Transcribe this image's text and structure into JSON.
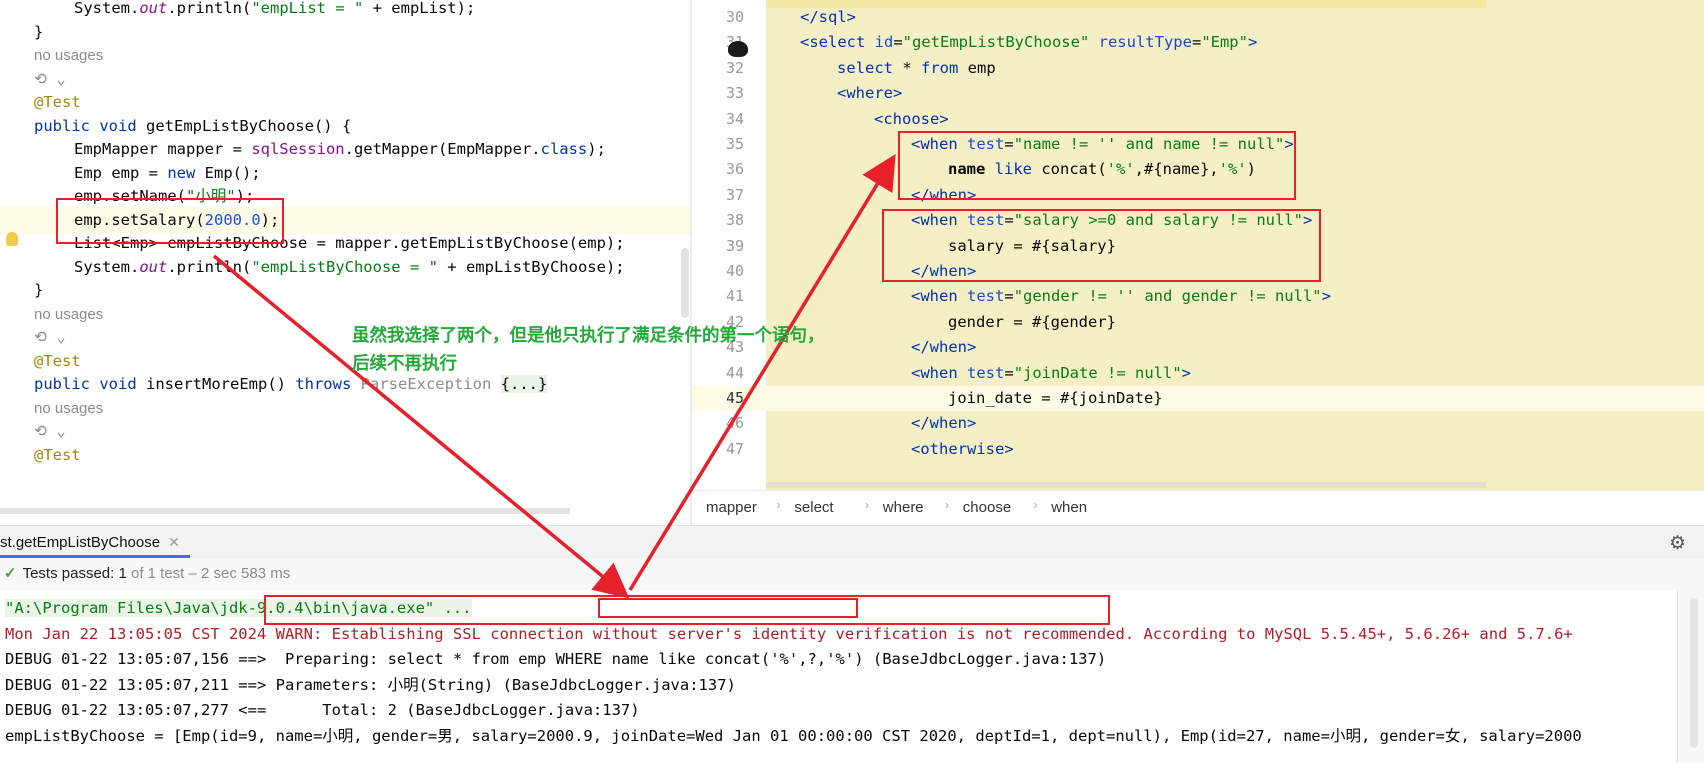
{
  "left_editor": {
    "lines": [
      {
        "kind": "code",
        "indent": true,
        "segments": [
          [
            "System.",
            ""
          ],
          [
            "out",
            "itl"
          ],
          [
            ".println(",
            ""
          ],
          [
            "\"empList = \"",
            "str"
          ],
          [
            " + empList);",
            ""
          ]
        ]
      },
      {
        "kind": "code",
        "indent": false,
        "segments": [
          [
            "}",
            ""
          ]
        ]
      },
      {
        "kind": "usage",
        "text": "no usages"
      },
      {
        "kind": "icon",
        "text": "⟲ ⌄"
      },
      {
        "kind": "code",
        "indent": false,
        "segments": [
          [
            "@Test",
            "ann"
          ]
        ]
      },
      {
        "kind": "code",
        "indent": false,
        "segments": [
          [
            "public",
            "kw"
          ],
          [
            " ",
            ""
          ],
          [
            "void",
            "kw"
          ],
          [
            " getEmpListByChoose() {",
            ""
          ]
        ]
      },
      {
        "kind": "code",
        "indent": true,
        "segments": [
          [
            "EmpMapper mapper = ",
            ""
          ],
          [
            "sqlSession",
            "fld"
          ],
          [
            ".getMapper(EmpMapper.",
            ""
          ],
          [
            "class",
            "kw"
          ],
          [
            ");",
            ""
          ]
        ]
      },
      {
        "kind": "code",
        "indent": true,
        "segments": [
          [
            "Emp emp = ",
            ""
          ],
          [
            "new",
            "kw"
          ],
          [
            " Emp();",
            ""
          ]
        ]
      },
      {
        "kind": "code",
        "indent": true,
        "segments": [
          [
            "emp.setName(",
            ""
          ],
          [
            "\"小明\"",
            "str"
          ],
          [
            ");",
            ""
          ]
        ]
      },
      {
        "kind": "code",
        "indent": true,
        "hl": true,
        "segments": [
          [
            "emp.setSalary(",
            ""
          ],
          [
            "2000.0",
            "num"
          ],
          [
            ");",
            ""
          ]
        ]
      },
      {
        "kind": "code",
        "indent": true,
        "segments": [
          [
            "List<Emp> empListByChoose = mapper.getEmpListByChoose(emp);",
            ""
          ]
        ]
      },
      {
        "kind": "code",
        "indent": true,
        "segments": [
          [
            "System.",
            ""
          ],
          [
            "out",
            "itl"
          ],
          [
            ".println(",
            ""
          ],
          [
            "\"empListByChoose = \"",
            "str"
          ],
          [
            " + empListByChoose);",
            ""
          ]
        ]
      },
      {
        "kind": "code",
        "indent": false,
        "segments": [
          [
            "}",
            ""
          ]
        ]
      },
      {
        "kind": "usage",
        "text": "no usages"
      },
      {
        "kind": "icon",
        "text": "⟲ ⌄"
      },
      {
        "kind": "code",
        "indent": false,
        "segments": [
          [
            "@Test",
            "ann"
          ]
        ]
      },
      {
        "kind": "code",
        "indent": false,
        "segments": [
          [
            "public",
            "kw"
          ],
          [
            " ",
            ""
          ],
          [
            "void",
            "kw"
          ],
          [
            " insertMoreEmp() ",
            ""
          ],
          [
            "throws",
            "kw"
          ],
          [
            " ",
            ""
          ],
          [
            "ParseException",
            "grey"
          ],
          [
            " ",
            ""
          ],
          [
            "{...}",
            "fold"
          ]
        ]
      },
      {
        "kind": "usage",
        "text": "no usages"
      },
      {
        "kind": "icon",
        "text": "⟲ ⌄"
      },
      {
        "kind": "code",
        "indent": false,
        "segments": [
          [
            "@Test",
            "ann"
          ]
        ]
      }
    ]
  },
  "right_editor": {
    "lines": [
      {
        "n": "30",
        "indent": 1,
        "segments": [
          [
            "</sql>",
            "tag"
          ]
        ]
      },
      {
        "n": "31",
        "indent": 1,
        "segments": [
          [
            "<select",
            "tag"
          ],
          [
            " id",
            "attr"
          ],
          [
            "=",
            ""
          ],
          [
            "\"getEmpListByChoose\"",
            "aval"
          ],
          [
            " resultType",
            "attr"
          ],
          [
            "=",
            ""
          ],
          [
            "\"Emp\"",
            "aval"
          ],
          [
            ">",
            "tag"
          ]
        ]
      },
      {
        "n": "32",
        "indent": 2,
        "segments": [
          [
            "select",
            "kw"
          ],
          [
            " * ",
            ""
          ],
          [
            "from",
            "kw"
          ],
          [
            " emp",
            ""
          ]
        ]
      },
      {
        "n": "33",
        "indent": 2,
        "segments": [
          [
            "<where>",
            "tag"
          ]
        ]
      },
      {
        "n": "34",
        "indent": 3,
        "segments": [
          [
            "<choose>",
            "tag"
          ]
        ]
      },
      {
        "n": "35",
        "indent": 4,
        "segments": [
          [
            "<when",
            "tag"
          ],
          [
            " test",
            "attr"
          ],
          [
            "=",
            ""
          ],
          [
            "\"name != '' and name != null\"",
            "aval"
          ],
          [
            ">",
            "tag"
          ]
        ]
      },
      {
        "n": "36",
        "indent": 5,
        "segments": [
          [
            "name",
            "bold"
          ],
          [
            " ",
            ""
          ],
          [
            "like",
            "kw"
          ],
          [
            " concat(",
            ""
          ],
          [
            "'%'",
            "aval"
          ],
          [
            ",#{name},",
            ""
          ],
          [
            "'%'",
            "aval"
          ],
          [
            ")",
            ""
          ]
        ]
      },
      {
        "n": "37",
        "indent": 4,
        "segments": [
          [
            "</when>",
            "tag"
          ]
        ]
      },
      {
        "n": "38",
        "indent": 4,
        "segments": [
          [
            "<when",
            "tag"
          ],
          [
            " test",
            "attr"
          ],
          [
            "=",
            ""
          ],
          [
            "\"salary >=0 and salary != null\"",
            "aval"
          ],
          [
            ">",
            "tag"
          ]
        ]
      },
      {
        "n": "39",
        "indent": 5,
        "segments": [
          [
            "salary = #{salary}",
            ""
          ]
        ]
      },
      {
        "n": "40",
        "indent": 4,
        "segments": [
          [
            "</when>",
            "tag"
          ]
        ]
      },
      {
        "n": "41",
        "indent": 4,
        "segments": [
          [
            "<when",
            "tag"
          ],
          [
            " test",
            "attr"
          ],
          [
            "=",
            ""
          ],
          [
            "\"gender != '' and gender != null\"",
            "aval"
          ],
          [
            ">",
            "tag"
          ]
        ]
      },
      {
        "n": "42",
        "indent": 5,
        "segments": [
          [
            "gender = #{gender}",
            ""
          ]
        ]
      },
      {
        "n": "43",
        "indent": 4,
        "segments": [
          [
            "</when>",
            "tag"
          ]
        ]
      },
      {
        "n": "44",
        "indent": 4,
        "segments": [
          [
            "<when",
            "tag"
          ],
          [
            " test",
            "attr"
          ],
          [
            "=",
            ""
          ],
          [
            "\"joinDate != null\"",
            "aval"
          ],
          [
            ">",
            "tag"
          ]
        ]
      },
      {
        "n": "45",
        "indent": 5,
        "cur": true,
        "segments": [
          [
            "join_date = #{joinDate}",
            ""
          ]
        ]
      },
      {
        "n": "46",
        "indent": 4,
        "segments": [
          [
            "</when>",
            "tag"
          ]
        ]
      },
      {
        "n": "47",
        "indent": 4,
        "segments": [
          [
            "<otherwise>",
            "tag"
          ]
        ]
      }
    ]
  },
  "breadcrumb": [
    "mapper",
    "select",
    "where",
    "choose",
    "when"
  ],
  "run_panel": {
    "tab_label": "st.getEmpListByChoose",
    "status_label": "Tests passed:",
    "status_count": "1",
    "status_detail": "of 1 test – 2 sec 583 ms"
  },
  "console": {
    "lines": [
      {
        "cls": "cmd-path",
        "text": "\"A:\\Program Files\\Java\\jdk-9.0.4\\bin\\java.exe\" ..."
      },
      {
        "cls": "warn",
        "text": "Mon Jan 22 13:05:05 CST 2024 WARN: Establishing SSL connection without server's identity verification is not recommended. According to MySQL 5.5.45+, 5.6.26+ and 5.7.6+"
      },
      {
        "cls": "",
        "text": "DEBUG 01-22 13:05:07,156 ==>  Preparing: select * from emp WHERE name like concat('%',?,'%') (BaseJdbcLogger.java:137)"
      },
      {
        "cls": "",
        "text": "DEBUG 01-22 13:05:07,211 ==> Parameters: 小明(String) (BaseJdbcLogger.java:137)"
      },
      {
        "cls": "",
        "text": "DEBUG 01-22 13:05:07,277 <==      Total: 2 (BaseJdbcLogger.java:137)"
      },
      {
        "cls": "",
        "text": "empListByChoose = [Emp(id=9, name=小明, gender=男, salary=2000.9, joinDate=Wed Jan 01 00:00:00 CST 2020, deptId=1, dept=null), Emp(id=27, name=小明, gender=女, salary=2000"
      }
    ]
  },
  "annotation": {
    "line1": "虽然我选择了两个，但是他只执行了满足条件的第一个语句，",
    "line2": "后续不再执行",
    "color": "#22aa3a"
  },
  "colors": {
    "highlight_box": "#e8202a",
    "arrow": "#e8202a",
    "xml_bg": "#f5efc5"
  }
}
